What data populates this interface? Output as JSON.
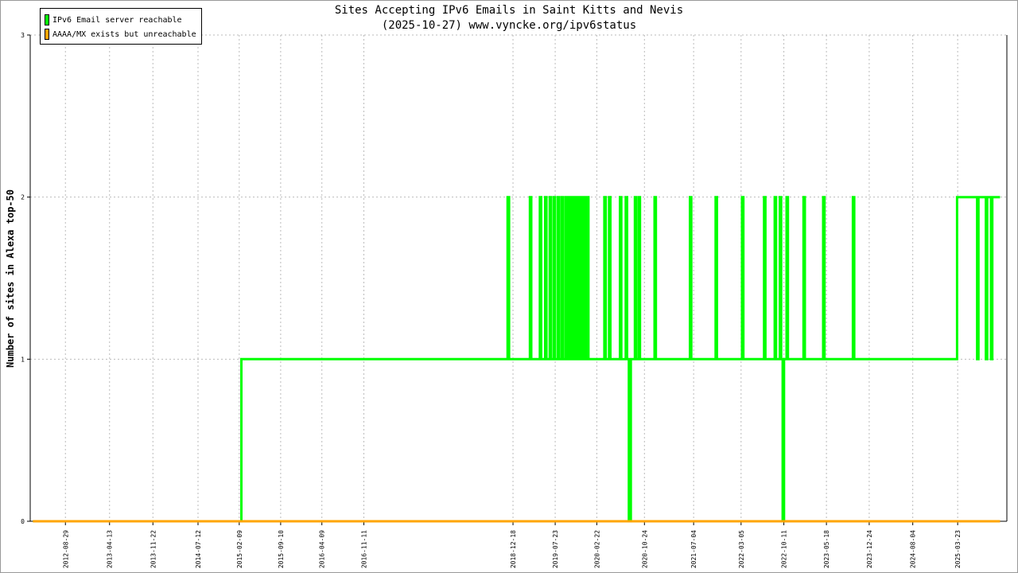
{
  "chart_data": {
    "type": "line",
    "title": "Sites Accepting IPv6 Emails in Saint Kitts and Nevis",
    "subtitle": "(2025-10-27) www.vyncke.org/ipv6status",
    "ylabel": "Number of sites in Alexa top-50",
    "xlabel": "",
    "ylim": [
      0,
      3
    ],
    "xlim": [
      "2012-03-01",
      "2025-12-01"
    ],
    "yticks": [
      "0",
      "1",
      "2",
      "3"
    ],
    "xticks": [
      "2012-08-29",
      "2013-04-13",
      "2013-11-22",
      "2014-07-12",
      "2015-02-09",
      "2015-09-10",
      "2016-04-09",
      "2016-11-11",
      "2018-12-18",
      "2019-07-23",
      "2020-02-22",
      "2020-10-24",
      "2021-07-04",
      "2022-03-05",
      "2022-10-11",
      "2023-05-18",
      "2023-12-24",
      "2024-08-04",
      "2025-03-23"
    ],
    "grid": true,
    "legend_position": "top-left",
    "series": [
      {
        "name": "IPv6 Email server reachable",
        "color": "#00ff00",
        "points": [
          [
            "2012-03-15",
            0
          ],
          [
            "2015-02-20",
            0
          ],
          [
            "2015-02-20",
            1
          ],
          [
            "2018-11-20",
            1
          ],
          [
            "2018-11-20",
            2
          ],
          [
            "2018-11-28",
            2
          ],
          [
            "2018-11-28",
            1
          ],
          [
            "2019-03-15",
            1
          ],
          [
            "2019-03-15",
            2
          ],
          [
            "2019-03-22",
            2
          ],
          [
            "2019-03-22",
            1
          ],
          [
            "2019-05-05",
            1
          ],
          [
            "2019-05-05",
            2
          ],
          [
            "2019-05-12",
            2
          ],
          [
            "2019-05-12",
            1
          ],
          [
            "2019-06-01",
            1
          ],
          [
            "2019-06-01",
            2
          ],
          [
            "2019-06-08",
            2
          ],
          [
            "2019-06-08",
            1
          ],
          [
            "2019-06-25",
            1
          ],
          [
            "2019-06-25",
            2
          ],
          [
            "2019-07-01",
            2
          ],
          [
            "2019-07-01",
            1
          ],
          [
            "2019-07-15",
            1
          ],
          [
            "2019-07-15",
            2
          ],
          [
            "2019-07-22",
            2
          ],
          [
            "2019-07-22",
            1
          ],
          [
            "2019-08-05",
            1
          ],
          [
            "2019-08-05",
            2
          ],
          [
            "2019-08-12",
            2
          ],
          [
            "2019-08-12",
            1
          ],
          [
            "2019-08-25",
            1
          ],
          [
            "2019-08-25",
            2
          ],
          [
            "2019-09-02",
            2
          ],
          [
            "2019-09-02",
            1
          ],
          [
            "2019-09-15",
            1
          ],
          [
            "2019-09-15",
            2
          ],
          [
            "2019-09-22",
            2
          ],
          [
            "2019-09-22",
            1
          ],
          [
            "2019-10-01",
            1
          ],
          [
            "2019-10-01",
            2
          ],
          [
            "2019-10-08",
            2
          ],
          [
            "2019-10-08",
            1
          ],
          [
            "2019-10-15",
            1
          ],
          [
            "2019-10-15",
            2
          ],
          [
            "2019-10-22",
            2
          ],
          [
            "2019-10-22",
            1
          ],
          [
            "2019-11-01",
            1
          ],
          [
            "2019-11-01",
            2
          ],
          [
            "2019-11-08",
            2
          ],
          [
            "2019-11-08",
            1
          ],
          [
            "2019-11-15",
            1
          ],
          [
            "2019-11-15",
            2
          ],
          [
            "2019-11-22",
            2
          ],
          [
            "2019-11-22",
            1
          ],
          [
            "2019-12-01",
            1
          ],
          [
            "2019-12-01",
            2
          ],
          [
            "2019-12-08",
            2
          ],
          [
            "2019-12-08",
            1
          ],
          [
            "2019-12-15",
            1
          ],
          [
            "2019-12-15",
            2
          ],
          [
            "2019-12-22",
            2
          ],
          [
            "2019-12-22",
            1
          ],
          [
            "2020-01-03",
            1
          ],
          [
            "2020-01-03",
            2
          ],
          [
            "2020-01-10",
            2
          ],
          [
            "2020-01-10",
            1
          ],
          [
            "2020-04-01",
            1
          ],
          [
            "2020-04-01",
            2
          ],
          [
            "2020-04-08",
            2
          ],
          [
            "2020-04-08",
            1
          ],
          [
            "2020-04-25",
            1
          ],
          [
            "2020-04-25",
            2
          ],
          [
            "2020-05-02",
            2
          ],
          [
            "2020-05-02",
            1
          ],
          [
            "2020-06-20",
            1
          ],
          [
            "2020-06-20",
            2
          ],
          [
            "2020-06-27",
            2
          ],
          [
            "2020-06-27",
            1
          ],
          [
            "2020-07-20",
            1
          ],
          [
            "2020-07-20",
            2
          ],
          [
            "2020-07-27",
            2
          ],
          [
            "2020-07-27",
            1
          ],
          [
            "2020-08-05",
            1
          ],
          [
            "2020-08-05",
            0
          ],
          [
            "2020-08-15",
            0
          ],
          [
            "2020-08-15",
            1
          ],
          [
            "2020-09-05",
            1
          ],
          [
            "2020-09-05",
            2
          ],
          [
            "2020-09-12",
            2
          ],
          [
            "2020-09-12",
            1
          ],
          [
            "2020-09-25",
            1
          ],
          [
            "2020-09-25",
            2
          ],
          [
            "2020-10-01",
            2
          ],
          [
            "2020-10-01",
            1
          ],
          [
            "2020-12-15",
            1
          ],
          [
            "2020-12-15",
            2
          ],
          [
            "2020-12-22",
            2
          ],
          [
            "2020-12-22",
            1
          ],
          [
            "2021-06-15",
            1
          ],
          [
            "2021-06-15",
            2
          ],
          [
            "2021-06-22",
            2
          ],
          [
            "2021-06-22",
            1
          ],
          [
            "2021-10-25",
            1
          ],
          [
            "2021-10-25",
            2
          ],
          [
            "2021-11-01",
            2
          ],
          [
            "2021-11-01",
            1
          ],
          [
            "2022-03-10",
            1
          ],
          [
            "2022-03-10",
            2
          ],
          [
            "2022-03-17",
            2
          ],
          [
            "2022-03-17",
            1
          ],
          [
            "2022-07-01",
            1
          ],
          [
            "2022-07-01",
            2
          ],
          [
            "2022-07-08",
            2
          ],
          [
            "2022-07-08",
            1
          ],
          [
            "2022-08-25",
            1
          ],
          [
            "2022-08-25",
            2
          ],
          [
            "2022-09-01",
            2
          ],
          [
            "2022-09-01",
            1
          ],
          [
            "2022-09-20",
            1
          ],
          [
            "2022-09-20",
            2
          ],
          [
            "2022-09-27",
            2
          ],
          [
            "2022-09-27",
            1
          ],
          [
            "2022-10-05",
            1
          ],
          [
            "2022-10-05",
            0
          ],
          [
            "2022-10-12",
            0
          ],
          [
            "2022-10-12",
            1
          ],
          [
            "2022-10-25",
            1
          ],
          [
            "2022-10-25",
            2
          ],
          [
            "2022-11-01",
            2
          ],
          [
            "2022-11-01",
            1
          ],
          [
            "2023-01-20",
            1
          ],
          [
            "2023-01-20",
            2
          ],
          [
            "2023-01-27",
            2
          ],
          [
            "2023-01-27",
            1
          ],
          [
            "2023-05-01",
            1
          ],
          [
            "2023-05-01",
            2
          ],
          [
            "2023-05-08",
            2
          ],
          [
            "2023-05-08",
            1
          ],
          [
            "2023-10-01",
            1
          ],
          [
            "2023-10-01",
            2
          ],
          [
            "2023-10-08",
            2
          ],
          [
            "2023-10-08",
            1
          ],
          [
            "2025-03-20",
            1
          ],
          [
            "2025-03-20",
            2
          ],
          [
            "2025-07-01",
            2
          ],
          [
            "2025-07-01",
            1
          ],
          [
            "2025-07-08",
            1
          ],
          [
            "2025-07-08",
            2
          ],
          [
            "2025-08-15",
            2
          ],
          [
            "2025-08-15",
            1
          ],
          [
            "2025-08-22",
            1
          ],
          [
            "2025-08-22",
            2
          ],
          [
            "2025-09-10",
            2
          ],
          [
            "2025-09-10",
            1
          ],
          [
            "2025-09-17",
            1
          ],
          [
            "2025-09-17",
            2
          ],
          [
            "2025-10-27",
            2
          ]
        ]
      },
      {
        "name": "AAAA/MX exists but unreachable",
        "color": "#ffa500",
        "points": [
          [
            "2012-03-15",
            0
          ],
          [
            "2025-10-27",
            0
          ]
        ]
      }
    ]
  }
}
